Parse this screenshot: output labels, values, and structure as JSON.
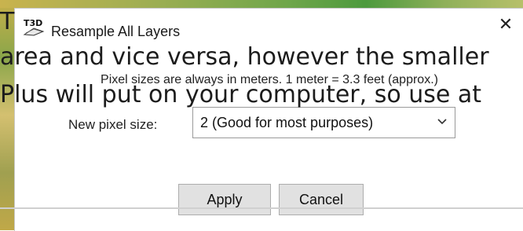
{
  "dialog": {
    "title": "Resample All Layers",
    "icon_label": "T3D",
    "close_label": "✕"
  },
  "note": "Pixel sizes are always in meters. 1 meter = 3.3 feet (approx.)",
  "pixel_size": {
    "label": "New pixel size:",
    "selected": "2 (Good for most purposes)"
  },
  "buttons": {
    "apply": "Apply",
    "cancel": "Cancel"
  },
  "background_text": {
    "line1": "T",
    "line2": "area and vice versa, however the smaller",
    "line3": "Plus will put on your computer, so use at"
  }
}
